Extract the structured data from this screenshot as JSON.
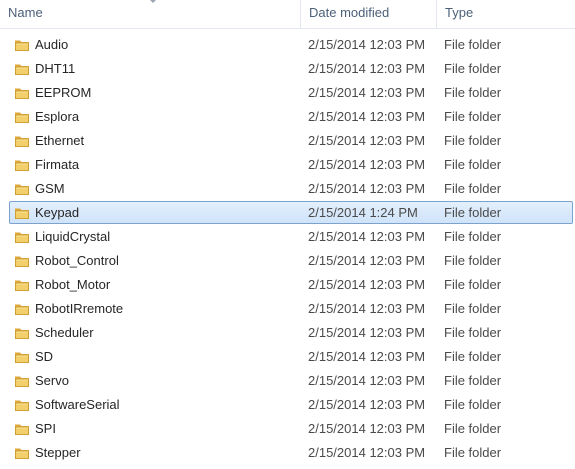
{
  "columns": {
    "name": "Name",
    "date_modified": "Date modified",
    "type": "Type"
  },
  "rows": [
    {
      "name": "Audio",
      "date": "2/15/2014 12:03 PM",
      "type": "File folder",
      "selected": false
    },
    {
      "name": "DHT11",
      "date": "2/15/2014 12:03 PM",
      "type": "File folder",
      "selected": false
    },
    {
      "name": "EEPROM",
      "date": "2/15/2014 12:03 PM",
      "type": "File folder",
      "selected": false
    },
    {
      "name": "Esplora",
      "date": "2/15/2014 12:03 PM",
      "type": "File folder",
      "selected": false
    },
    {
      "name": "Ethernet",
      "date": "2/15/2014 12:03 PM",
      "type": "File folder",
      "selected": false
    },
    {
      "name": "Firmata",
      "date": "2/15/2014 12:03 PM",
      "type": "File folder",
      "selected": false
    },
    {
      "name": "GSM",
      "date": "2/15/2014 12:03 PM",
      "type": "File folder",
      "selected": false
    },
    {
      "name": "Keypad",
      "date": "2/15/2014 1:24 PM",
      "type": "File folder",
      "selected": true
    },
    {
      "name": "LiquidCrystal",
      "date": "2/15/2014 12:03 PM",
      "type": "File folder",
      "selected": false
    },
    {
      "name": "Robot_Control",
      "date": "2/15/2014 12:03 PM",
      "type": "File folder",
      "selected": false
    },
    {
      "name": "Robot_Motor",
      "date": "2/15/2014 12:03 PM",
      "type": "File folder",
      "selected": false
    },
    {
      "name": "RobotIRremote",
      "date": "2/15/2014 12:03 PM",
      "type": "File folder",
      "selected": false
    },
    {
      "name": "Scheduler",
      "date": "2/15/2014 12:03 PM",
      "type": "File folder",
      "selected": false
    },
    {
      "name": "SD",
      "date": "2/15/2014 12:03 PM",
      "type": "File folder",
      "selected": false
    },
    {
      "name": "Servo",
      "date": "2/15/2014 12:03 PM",
      "type": "File folder",
      "selected": false
    },
    {
      "name": "SoftwareSerial",
      "date": "2/15/2014 12:03 PM",
      "type": "File folder",
      "selected": false
    },
    {
      "name": "SPI",
      "date": "2/15/2014 12:03 PM",
      "type": "File folder",
      "selected": false
    },
    {
      "name": "Stepper",
      "date": "2/15/2014 12:03 PM",
      "type": "File folder",
      "selected": false
    }
  ],
  "icons": {
    "row_icon": "folder-icon",
    "sort_indicator": "sort-caret-icon"
  },
  "colors": {
    "selection_border": "#7da2ce",
    "selection_fill": "#cfe3fa",
    "header_text": "#4c607a",
    "folder": "#e8c15a"
  }
}
